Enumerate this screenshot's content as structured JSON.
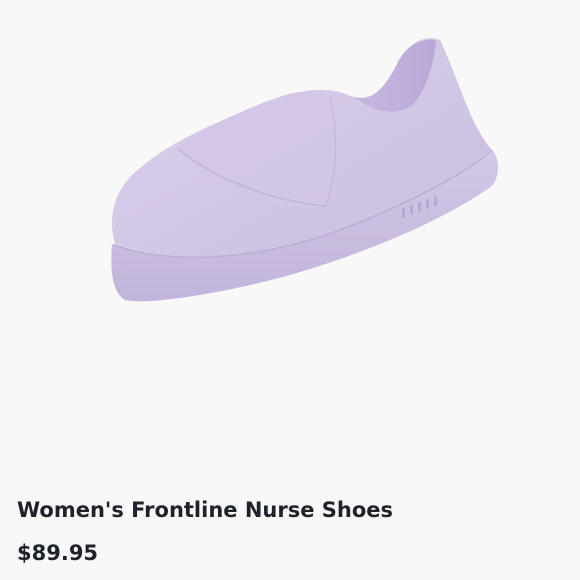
{
  "product": {
    "title": "Women's Frontline Nurse Shoes",
    "price": "$89.95",
    "image_alt": "Lavender slip-on nurse shoe",
    "shoe_color": "#d6cbe6"
  }
}
